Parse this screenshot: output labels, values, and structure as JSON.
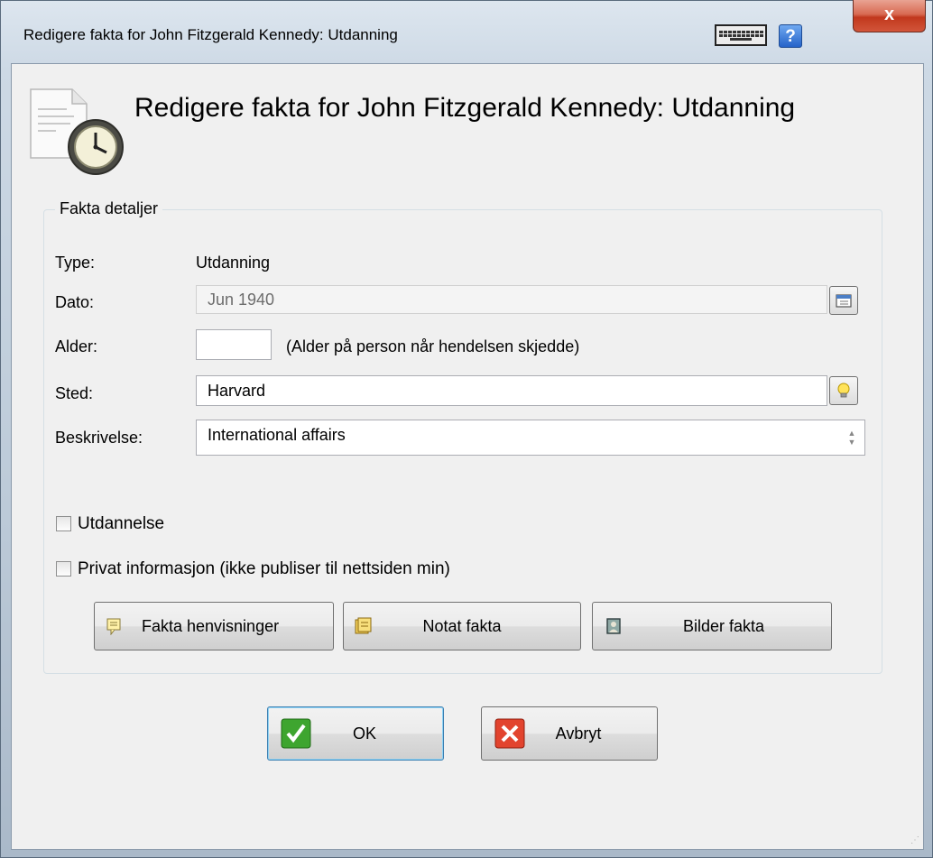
{
  "window": {
    "title": "Redigere fakta for John Fitzgerald Kennedy: Utdanning",
    "close_glyph": "x"
  },
  "header": {
    "title": "Redigere fakta for John Fitzgerald Kennedy: Utdanning"
  },
  "group": {
    "label": "Fakta detaljer"
  },
  "fields": {
    "type_label": "Type:",
    "type_value": "Utdanning",
    "date_label": "Dato:",
    "date_value": "Jun 1940",
    "age_label": "Alder:",
    "age_value": "",
    "age_hint": "(Alder på person når hendelsen skjedde)",
    "place_label": "Sted:",
    "place_value": "Harvard",
    "desc_label": "Beskrivelse:",
    "desc_value": "International affairs"
  },
  "checkboxes": {
    "education_label": "Utdannelse",
    "education_checked": false,
    "private_label": "Privat informasjon (ikke publiser til nettsiden min)",
    "private_checked": false
  },
  "buttons": {
    "sources": "Fakta henvisninger",
    "notes": "Notat fakta",
    "images": "Bilder fakta",
    "ok": "OK",
    "cancel": "Avbryt"
  },
  "icons": {
    "keyboard": "keyboard-icon",
    "help": "help-icon",
    "header": "fact-clock-document-icon",
    "date_picker": "calendar-icon",
    "place_lookup": "lightbulb-icon",
    "sources": "citation-icon",
    "notes": "notes-icon",
    "images": "picture-icon",
    "ok": "checkmark-icon",
    "cancel": "x-icon"
  },
  "colors": {
    "ok_green": "#3ea52f",
    "cancel_red": "#e2442e",
    "close_red": "#c8452b"
  }
}
